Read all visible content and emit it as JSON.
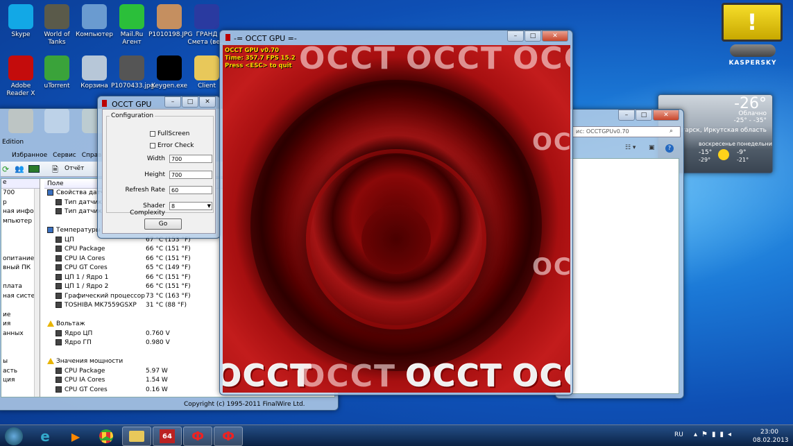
{
  "desktop_icons": [
    {
      "label": "Skype",
      "icon": "skype-icon",
      "color": "#12a8e6"
    },
    {
      "label": "World of Tanks",
      "icon": "tanks-icon",
      "color": "#5a5a4a"
    },
    {
      "label": "Компьютер",
      "icon": "computer-icon",
      "color": "#6a9bd0"
    },
    {
      "label": "Mail.Ru Агент",
      "icon": "mailru-agent-icon",
      "color": "#2bbf3a"
    },
    {
      "label": "P1010198.JPG",
      "icon": "photo-icon",
      "color": "#c58f60"
    },
    {
      "label": "ГРАНД Смета (ве...",
      "icon": "grand-smeta-icon",
      "color": "#2a3aa0"
    },
    {
      "label": "Adobe Reader X",
      "icon": "adobe-reader-icon",
      "color": "#c40c0c"
    },
    {
      "label": "uTorrent",
      "icon": "utorrent-icon",
      "color": "#3aa33a"
    },
    {
      "label": "Корзина",
      "icon": "recycle-bin-icon",
      "color": "#b7c7d8"
    },
    {
      "label": "P1070433.jpg",
      "icon": "photo-icon",
      "color": "#555"
    },
    {
      "label": "Keygen.exe",
      "icon": "yin-yang-icon",
      "color": "#000"
    },
    {
      "label": "Client",
      "icon": "folder-icon",
      "color": "#e8c85a"
    },
    {
      "label": "",
      "icon": "avast-icon",
      "color": "#f09c00"
    },
    {
      "label": "",
      "icon": "document-icon",
      "color": "#eee"
    },
    {
      "label": "",
      "icon": "folder-icon",
      "color": "#e8c85a"
    }
  ],
  "aida": {
    "title_fragment": "Edition",
    "menu": [
      "Избранное",
      "Сервис",
      "Справка"
    ],
    "toolbar_report": "Отчёт",
    "column_field": "Поле",
    "tree_items": [
      "700",
      "р",
      "ная инфор",
      "мпьютер",
      "",
      "",
      "",
      "опитание",
      "вный ПК",
      "",
      "плата",
      "ная систем",
      "",
      "ие",
      "ия",
      "анных",
      "",
      "",
      "ы",
      "асть",
      "ция"
    ],
    "rows": [
      {
        "type": "header",
        "label": "Свойства датчи"
      },
      {
        "type": "item",
        "label": "Тип датчика",
        "value": ""
      },
      {
        "type": "item",
        "label": "Тип датчика",
        "value": ""
      },
      {
        "type": "gap"
      },
      {
        "type": "header",
        "label": "Температуры"
      },
      {
        "type": "item",
        "label": "ЦП",
        "value": "67 °C  (153 °F)"
      },
      {
        "type": "item",
        "label": "CPU Package",
        "value": "66 °C  (151 °F)"
      },
      {
        "type": "item",
        "label": "CPU IA Cores",
        "value": "66 °C  (151 °F)"
      },
      {
        "type": "item",
        "label": "CPU GT Cores",
        "value": "65 °C  (149 °F)"
      },
      {
        "type": "item",
        "label": "ЦП 1 / Ядро 1",
        "value": "66 °C  (151 °F)"
      },
      {
        "type": "item",
        "label": "ЦП 1 / Ядро 2",
        "value": "66 °C  (151 °F)"
      },
      {
        "type": "item",
        "label": "Графический процессор",
        "value": "73 °C  (163 °F)"
      },
      {
        "type": "item",
        "label": "TOSHIBA MK7559GSXP",
        "value": "31 °C  (88 °F)"
      },
      {
        "type": "gap"
      },
      {
        "type": "warnheader",
        "label": "Вольтаж"
      },
      {
        "type": "item",
        "label": "Ядро ЦП",
        "value": "0.760 V"
      },
      {
        "type": "item",
        "label": "Ядро ГП",
        "value": "0.980 V"
      },
      {
        "type": "gap"
      },
      {
        "type": "warnheader",
        "label": "Значения мощности"
      },
      {
        "type": "item",
        "label": "CPU Package",
        "value": "5.97 W"
      },
      {
        "type": "item",
        "label": "CPU IA Cores",
        "value": "1.54 W"
      },
      {
        "type": "item",
        "label": "CPU GT Cores",
        "value": "0.16 W"
      }
    ],
    "copyright": "Copyright (c) 1995-2011 FinalWire Ltd."
  },
  "occt_cfg": {
    "title": "OCCT GPU",
    "group": "Configuration",
    "fullscreen": "FullScreen",
    "errorcheck": "Error Check",
    "width_label": "Width",
    "width": "700",
    "height_label": "Height",
    "height": "700",
    "refresh_label": "Refresh Rate",
    "refresh": "60",
    "shader_label": "Shader Complexity",
    "shader": "8",
    "go": "Go"
  },
  "gpu": {
    "title": "-= OCCT GPU =-",
    "hud": [
      "OCCT GPU v0.70",
      "Time: 357.7  FPS 15.2",
      "Press <ESC> to quit"
    ],
    "logo": "OCCT"
  },
  "explorer": {
    "search": "ис: OCCTGPUv0.70"
  },
  "kaspersky": {
    "brand": "KASPERSKY",
    "mark": "!"
  },
  "weather": {
    "temp": "-26°",
    "cond": "Облачно",
    "range": "-25° - -35°",
    "place": "Ангарск, Иркутская область",
    "days": [
      {
        "name": "воскресенье",
        "hi": "-15°",
        "lo": "-29°"
      },
      {
        "name": "понедельник",
        "hi": "-9°",
        "lo": "-21°"
      }
    ]
  },
  "tray": {
    "lang": "RU",
    "time": "23:00",
    "date": "08.02.2013"
  }
}
